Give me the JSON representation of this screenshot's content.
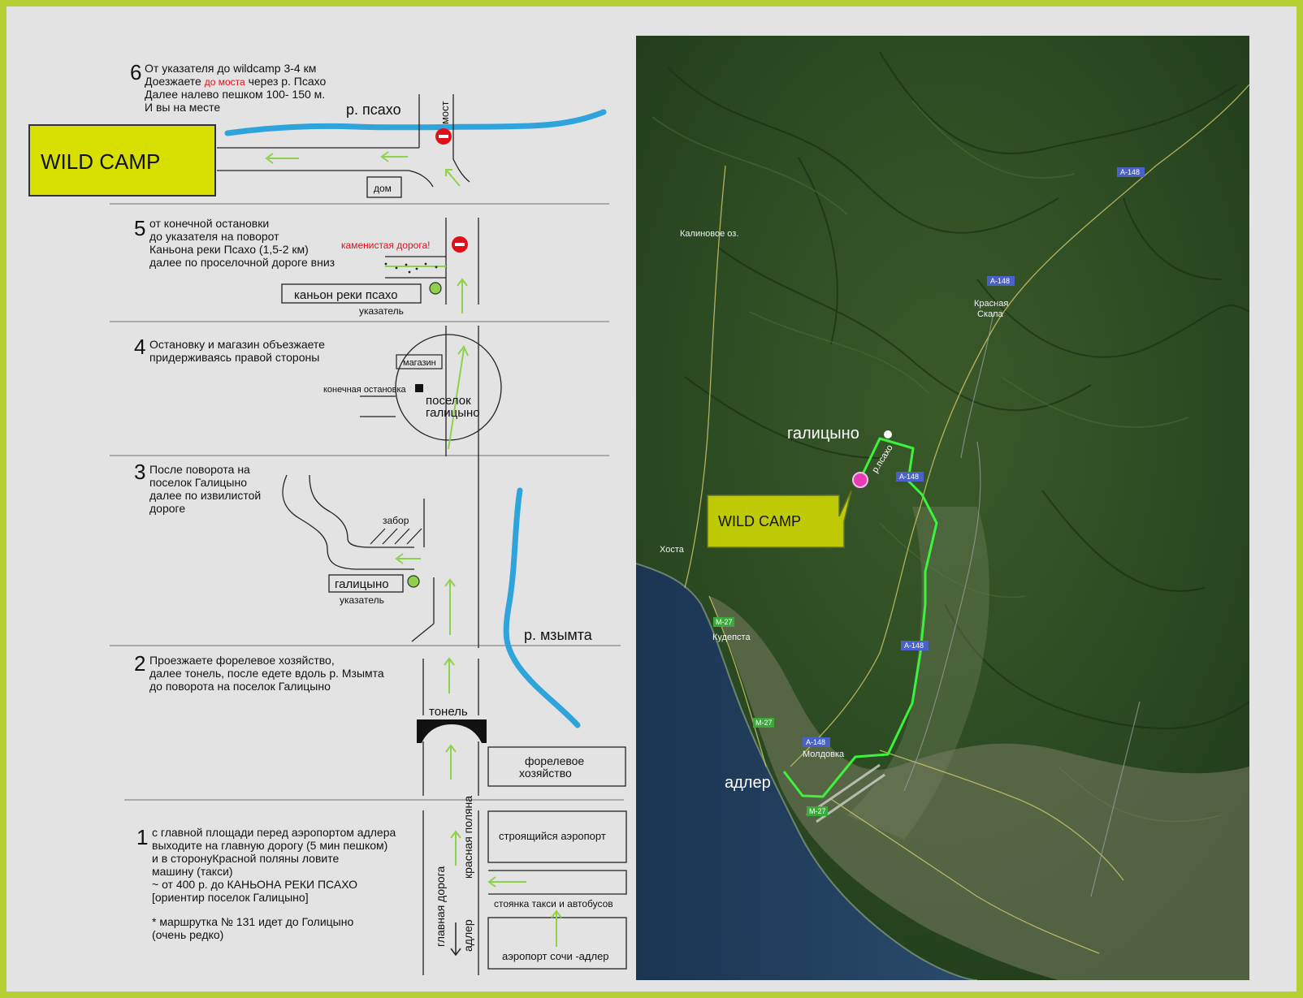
{
  "colors": {
    "frame": "#b6d033",
    "background": "#e3e3e3",
    "label_yellow": "#d8e000",
    "river": "#2fa3dc",
    "arrow": "#8ed14a",
    "route": "#3df23d",
    "warning": "#e0101a",
    "sign_dot": "#8ed14a",
    "destination": "#e83cb5"
  },
  "icons": [
    "no-entry-icon",
    "signpost-dot-icon",
    "up-arrow-icon",
    "left-arrow-icon",
    "tunnel-icon",
    "map-pin-icon"
  ],
  "wild_camp_label": "WILD CAMP",
  "step6": {
    "number": "6",
    "line1": "От указателя до wildcamp 3-4 км",
    "line2_pre": "Доезжаете ",
    "line2_red": "до моста",
    "line2_post": " через р. Псахо",
    "line3": "Далее налево пешком 100- 150 м.",
    "line4": "И вы на месте",
    "river_label": "р. псахо",
    "bridge_label": "мост",
    "house_label": "дом"
  },
  "step5": {
    "number": "5",
    "lines": [
      "от конечной остановки",
      "до указателя на поворот",
      "Каньона реки Псахо (1,5-2 км)",
      "далее по проселочной дороге вниз"
    ],
    "warning": "каменистая дорога!",
    "sign_label": "каньон реки псахо",
    "sign_caption": "указатель"
  },
  "step4": {
    "number": "4",
    "lines": [
      "Остановку и магазин объезжаете",
      "придерживаясь правой стороны"
    ],
    "shop_label": "магазин",
    "stop_label": "конечная остановка",
    "village_line1": "поселок",
    "village_line2": "галицыно"
  },
  "step3": {
    "number": "3",
    "lines": [
      "После поворота на",
      "поселок Галицыно",
      "далее по извилистой",
      " дороге"
    ],
    "fence_label": "забор",
    "sign_label": "галицыно",
    "sign_caption": "указатель",
    "river_label": "р. мзымта"
  },
  "step2": {
    "number": "2",
    "lines": [
      "Проезжаете форелевое хозяйство,",
      "далее тонель, после едете  вдоль р. Мзымта",
      " до поворота на поселок Галицыно"
    ],
    "tunnel_label": "тонель",
    "farm_line1": "форелевое",
    "farm_line2": "хозяйство"
  },
  "step1": {
    "number": "1",
    "lines": [
      "с главной площади перед аэропортом адлера",
      "выходите на главную дорогу (5 мин пешком)",
      " и в сторонуКрасной поляны ловите",
      "машину (такси)",
      "~ от 400 р. до КАНЬОНА РЕКИ ПСАХО",
      "[ориентир поселок Галицыно]"
    ],
    "note_lines": [
      "* маршрутка № 131 идет до Голицыно",
      "(очень редко)"
    ],
    "road_main": "главная дорога",
    "road_polyana": "красная поляна",
    "road_adler": "адлер",
    "building_construction": "строящийся аэропорт",
    "taxi_label": "стоянка такси и автобусов",
    "airport_label": "аэропорт сочи -адлер"
  },
  "map": {
    "wild_camp_label": "WILD CAMP",
    "galitsyno": "галицыно",
    "adler": "адлер",
    "psakho": "р.псахо",
    "kalinovoe": "Калиновое оз.",
    "krasnaya_line1": "Красная",
    "krasnaya_line2": "Скала",
    "khosta": "Хоста",
    "kudepsta": "Кудепста",
    "moldovka": "Молдовка",
    "road_a148": "А-148",
    "road_m27": "М-27"
  }
}
